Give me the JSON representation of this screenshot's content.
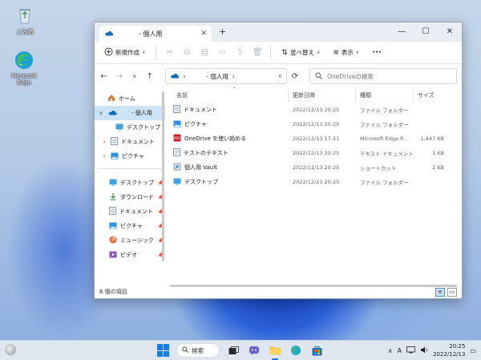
{
  "desktop": {
    "icons": [
      {
        "label": "ごみ箱"
      },
      {
        "label": "Microsoft Edge"
      }
    ]
  },
  "window": {
    "tab": {
      "title": "- 個人用"
    },
    "controls": {
      "minimize": "—",
      "maximize": "☐",
      "close": "✕"
    },
    "toolbar": {
      "new_label": "新規作成",
      "sort_label": "並べ替え",
      "view_label": "表示",
      "more_label": "···"
    },
    "address": {
      "path": "- 個人用"
    },
    "search": {
      "placeholder": "OneDriveの検索"
    },
    "sidebar": {
      "items": [
        {
          "label": "ホーム"
        },
        {
          "label": "- 個人用"
        },
        {
          "label": "デスクトップ"
        },
        {
          "label": "ドキュメント"
        },
        {
          "label": "ピクチャ"
        }
      ],
      "quick": [
        {
          "label": "デスクトップ"
        },
        {
          "label": "ダウンロード"
        },
        {
          "label": "ドキュメント"
        },
        {
          "label": "ピクチャ"
        },
        {
          "label": "ミュージック"
        },
        {
          "label": "ビデオ"
        }
      ]
    },
    "columns": {
      "name": "名前",
      "date": "更新日時",
      "type": "種類",
      "size": "サイズ"
    },
    "files": [
      {
        "name": "ドキュメント",
        "date": "2022/12/13 20:25",
        "type": "ファイル フォルダー",
        "size": ""
      },
      {
        "name": "ピクチャ",
        "date": "2022/12/13 20:25",
        "type": "ファイル フォルダー",
        "size": ""
      },
      {
        "name": "OneDrive を使い始める",
        "date": "2022/12/13 17:51",
        "type": "Microsoft Edge P...",
        "size": "1,447 KB"
      },
      {
        "name": "テストのテキスト",
        "date": "2022/12/13 20:25",
        "type": "テキスト ドキュメント",
        "size": "1 KB"
      },
      {
        "name": "個人用 Vault",
        "date": "2022/12/13 20:25",
        "type": "ショートカット",
        "size": "2 KB"
      },
      {
        "name": "デスクトップ",
        "date": "2022/12/13 20:25",
        "type": "ファイル フォルダー",
        "size": ""
      }
    ],
    "status": {
      "count": "6 個の項目"
    }
  },
  "taskbar": {
    "search_label": "検索",
    "ime": "A",
    "time": "20:25",
    "date": "2022/12/13"
  },
  "colors": {
    "accent": "#1c7be0",
    "onedrive": "#0f6cbd",
    "folder": "#f3c13a",
    "selected": "#cce4f7"
  }
}
